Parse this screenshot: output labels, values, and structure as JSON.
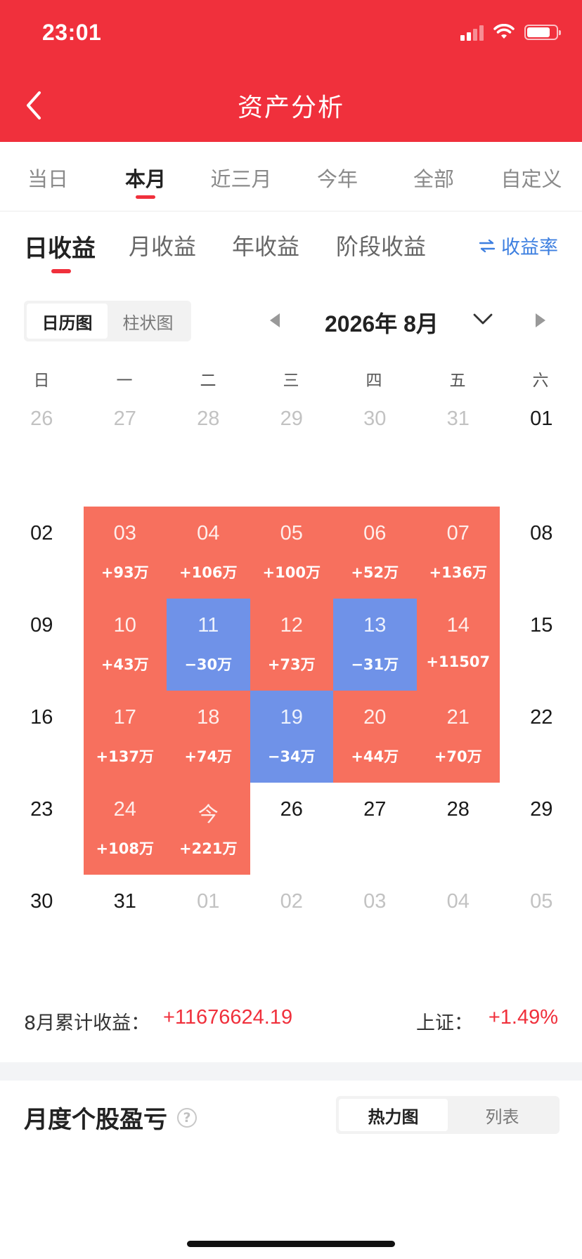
{
  "status_bar": {
    "time": "23:01"
  },
  "nav": {
    "title": "资产分析"
  },
  "period_tabs": [
    {
      "label": "当日",
      "active": false
    },
    {
      "label": "本月",
      "active": true
    },
    {
      "label": "近三月",
      "active": false
    },
    {
      "label": "今年",
      "active": false
    },
    {
      "label": "全部",
      "active": false
    },
    {
      "label": "自定义",
      "active": false
    }
  ],
  "income_tabs": [
    {
      "label": "日收益",
      "active": true
    },
    {
      "label": "月收益",
      "active": false
    },
    {
      "label": "年收益",
      "active": false
    },
    {
      "label": "阶段收益",
      "active": false
    }
  ],
  "rate_toggle": {
    "icon": "swap-arrows-icon",
    "label": "收益率"
  },
  "view_toggle": [
    {
      "label": "日历图",
      "active": true
    },
    {
      "label": "柱状图",
      "active": false
    }
  ],
  "month_nav": {
    "label": "2026年 8月"
  },
  "weekdays": [
    "日",
    "一",
    "二",
    "三",
    "四",
    "五",
    "六"
  ],
  "calendar": [
    [
      {
        "day": "26",
        "type": "other"
      },
      {
        "day": "27",
        "type": "other"
      },
      {
        "day": "28",
        "type": "other"
      },
      {
        "day": "29",
        "type": "other"
      },
      {
        "day": "30",
        "type": "other"
      },
      {
        "day": "31",
        "type": "other"
      },
      {
        "day": "01",
        "type": "normal"
      }
    ],
    [
      {
        "day": "02",
        "type": "normal"
      },
      {
        "day": "03",
        "type": "pos",
        "amount": "+93万"
      },
      {
        "day": "04",
        "type": "pos",
        "amount": "+106万"
      },
      {
        "day": "05",
        "type": "pos",
        "amount": "+100万"
      },
      {
        "day": "06",
        "type": "pos",
        "amount": "+52万"
      },
      {
        "day": "07",
        "type": "pos",
        "amount": "+136万"
      },
      {
        "day": "08",
        "type": "normal"
      }
    ],
    [
      {
        "day": "09",
        "type": "normal"
      },
      {
        "day": "10",
        "type": "pos",
        "amount": "+43万"
      },
      {
        "day": "11",
        "type": "neg",
        "amount": "−30万"
      },
      {
        "day": "12",
        "type": "pos",
        "amount": "+73万"
      },
      {
        "day": "13",
        "type": "neg",
        "amount": "−31万"
      },
      {
        "day": "14",
        "type": "pos",
        "amount": "+11507"
      },
      {
        "day": "15",
        "type": "normal"
      }
    ],
    [
      {
        "day": "16",
        "type": "normal"
      },
      {
        "day": "17",
        "type": "pos",
        "amount": "+137万"
      },
      {
        "day": "18",
        "type": "pos",
        "amount": "+74万"
      },
      {
        "day": "19",
        "type": "neg",
        "amount": "−34万"
      },
      {
        "day": "20",
        "type": "pos",
        "amount": "+44万"
      },
      {
        "day": "21",
        "type": "pos",
        "amount": "+70万"
      },
      {
        "day": "22",
        "type": "normal"
      }
    ],
    [
      {
        "day": "23",
        "type": "normal"
      },
      {
        "day": "24",
        "type": "pos",
        "amount": "+108万"
      },
      {
        "day": "今",
        "type": "pos",
        "amount": "+221万"
      },
      {
        "day": "26",
        "type": "normal"
      },
      {
        "day": "27",
        "type": "normal"
      },
      {
        "day": "28",
        "type": "normal"
      },
      {
        "day": "29",
        "type": "normal"
      }
    ],
    [
      {
        "day": "30",
        "type": "normal"
      },
      {
        "day": "31",
        "type": "normal"
      },
      {
        "day": "01",
        "type": "other"
      },
      {
        "day": "02",
        "type": "other"
      },
      {
        "day": "03",
        "type": "other"
      },
      {
        "day": "04",
        "type": "other"
      },
      {
        "day": "05",
        "type": "other"
      }
    ]
  ],
  "summary": {
    "month_label": "8月累计收益：",
    "month_value": "+11676624.19",
    "index_label": "上证：",
    "index_value": "+1.49%"
  },
  "stock_section": {
    "title": "月度个股盈亏",
    "help_icon": "question-circle-icon",
    "view_toggle": [
      {
        "label": "热力图",
        "active": true
      },
      {
        "label": "列表",
        "active": false
      }
    ]
  },
  "colors": {
    "brand_red": "#f0303c",
    "gain_cell": "#f7705e",
    "loss_cell": "#6f92e8",
    "link_blue": "#3d7fe0"
  }
}
